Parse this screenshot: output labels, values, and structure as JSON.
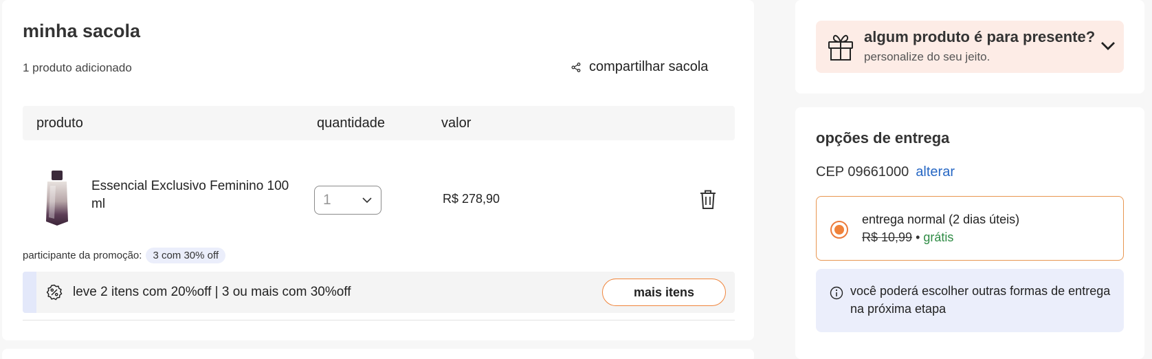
{
  "bag": {
    "title": "minha sacola",
    "count_text": "1 produto adicionado",
    "share_label": "compartilhar sacola",
    "table_headers": {
      "product": "produto",
      "quantity": "quantidade",
      "value": "valor"
    },
    "items": [
      {
        "name": "Essencial Exclusivo Feminino 100 ml",
        "quantity": "1",
        "price": "R$ 278,90"
      }
    ],
    "promo_label": "participante da promoção:",
    "promo_tag": "3 com 30% off",
    "promo_text": "leve 2 itens com 20%off | 3 ou mais com 30%off",
    "more_items_label": "mais itens"
  },
  "gift": {
    "title": "algum produto é para presente?",
    "subtitle": "personalize do seu jeito."
  },
  "delivery": {
    "title": "opções de entrega",
    "cep_text": "CEP 09661000",
    "change_label": "alterar",
    "option": {
      "title": "entrega normal (2 dias úteis)",
      "old_price": "R$ 10,99",
      "separator": "•",
      "new_price": "grátis"
    },
    "info_text": "você poderá escolher outras formas de entrega na próxima etapa"
  },
  "colors": {
    "accent": "#f0843a",
    "link": "#2667c4",
    "free": "#2e8b44",
    "gift_bg": "#fdece6",
    "info_bg": "#ebeefb"
  }
}
